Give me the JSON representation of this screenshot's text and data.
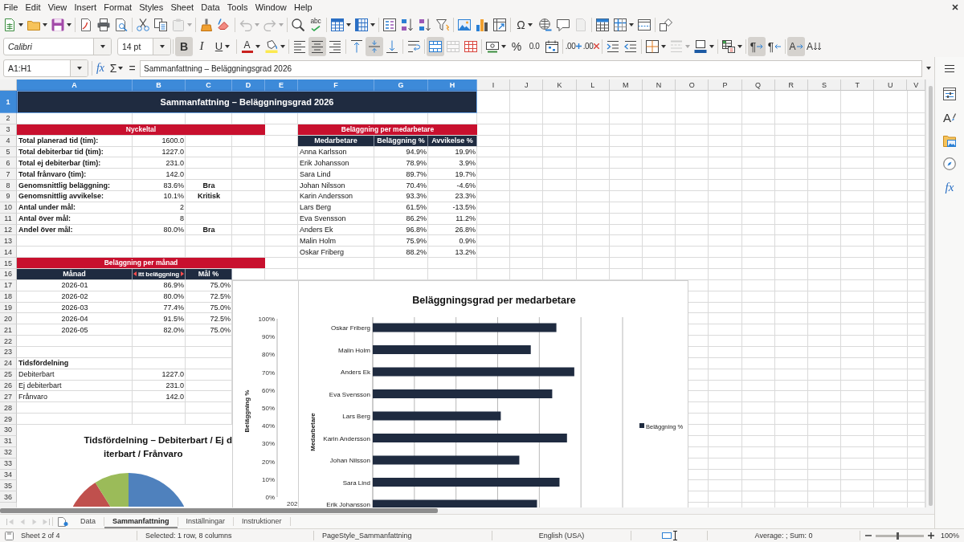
{
  "menu_bar": {
    "items": [
      "File",
      "Edit",
      "View",
      "Insert",
      "Format",
      "Styles",
      "Sheet",
      "Data",
      "Tools",
      "Window",
      "Help"
    ]
  },
  "standard_toolbar": [
    [
      {
        "disabled": false,
        "menu": true
      },
      {
        "disabled": false,
        "menu": true
      },
      {
        "disabled": false,
        "menu": true
      }
    ],
    [
      {
        "disabled": false,
        "menu": false
      },
      {
        "disabled": false,
        "menu": false
      },
      {
        "disabled": false,
        "menu": false
      }
    ],
    [
      {
        "disabled": false,
        "menu": false
      },
      {
        "disabled": false,
        "menu": false
      },
      {
        "disabled": true,
        "menu": true
      }
    ],
    [
      {
        "disabled": false,
        "menu": false
      },
      {
        "disabled": false,
        "menu": false
      }
    ],
    [
      {
        "disabled": true,
        "menu": true
      },
      {
        "disabled": true,
        "menu": true
      }
    ],
    [
      {
        "disabled": false,
        "menu": false
      },
      {
        "label": "abc",
        "disabled": false,
        "menu": false
      }
    ],
    [
      {
        "disabled": false,
        "menu": true
      },
      {
        "disabled": false,
        "menu": true
      }
    ],
    [
      {
        "disabled": false,
        "menu": false
      },
      {
        "disabled": false,
        "menu": false
      },
      {
        "disabled": false,
        "menu": false
      },
      {
        "disabled": false,
        "menu": false
      }
    ],
    [
      {
        "disabled": false,
        "menu": false
      },
      {
        "disabled": false,
        "menu": false
      },
      {
        "disabled": false,
        "menu": false
      }
    ],
    [
      {
        "label": "Ω",
        "disabled": false,
        "menu": true
      },
      {
        "disabled": false,
        "menu": false
      },
      {
        "disabled": false,
        "menu": false
      },
      {
        "disabled": true,
        "menu": false
      }
    ],
    [
      {
        "disabled": false,
        "menu": false
      },
      {
        "disabled": false,
        "menu": true
      },
      {
        "disabled": false,
        "menu": false
      }
    ],
    [
      {
        "disabled": false,
        "menu": false
      }
    ]
  ],
  "formatting_toolbar": {
    "font_name": "Calibri",
    "font_size": "14 pt",
    "groups": [
      [
        {
          "label": "B",
          "pressed": true,
          "disabled": false,
          "menu": false
        },
        {
          "label": "I",
          "pressed": false,
          "disabled": false,
          "menu": false
        },
        {
          "label": "U",
          "pressed": false,
          "disabled": false,
          "menu": true
        }
      ],
      [
        {
          "label": "A",
          "pressed": false,
          "disabled": false,
          "menu": true
        },
        {
          "pressed": false,
          "disabled": false,
          "menu": true
        }
      ],
      [
        {
          "pressed": false,
          "disabled": false,
          "menu": false
        },
        {
          "pressed": true,
          "disabled": false,
          "menu": false
        },
        {
          "pressed": false,
          "disabled": false,
          "menu": false
        }
      ],
      [
        {
          "pressed": false,
          "disabled": false,
          "menu": false
        },
        {
          "pressed": true,
          "disabled": false,
          "menu": false
        },
        {
          "pressed": false,
          "disabled": false,
          "menu": false
        }
      ],
      [
        {
          "pressed": false,
          "disabled": false,
          "menu": false
        }
      ],
      [
        {
          "pressed": true,
          "disabled": false,
          "menu": false
        },
        {
          "pressed": false,
          "disabled": true,
          "menu": false
        },
        {
          "pressed": false,
          "disabled": false,
          "menu": false
        }
      ],
      [
        {
          "pressed": false,
          "disabled": false,
          "menu": true
        },
        {
          "label": "%",
          "pressed": false,
          "disabled": false,
          "menu": false
        },
        {
          "label": "0.0",
          "pressed": false,
          "disabled": false,
          "menu": false
        },
        {
          "pressed": false,
          "disabled": false,
          "menu": false
        }
      ],
      [
        {
          "label": ".00",
          "pressed": false,
          "disabled": false,
          "menu": false
        },
        {
          "label": ".00",
          "pressed": false,
          "disabled": false,
          "menu": false
        }
      ],
      [
        {
          "pressed": false,
          "disabled": false,
          "menu": false
        },
        {
          "pressed": false,
          "disabled": false,
          "menu": false
        }
      ],
      [
        {
          "pressed": false,
          "disabled": false,
          "menu": true
        },
        {
          "pressed": false,
          "disabled": true,
          "menu": true
        },
        {
          "pressed": false,
          "disabled": false,
          "menu": true
        }
      ],
      [
        {
          "pressed": false,
          "disabled": false,
          "menu": true
        }
      ],
      [
        {
          "label": "¶",
          "pressed": true,
          "disabled": false,
          "menu": false
        },
        {
          "label": "¶",
          "pressed": false,
          "disabled": false,
          "menu": false
        }
      ],
      [
        {
          "label": "A",
          "pressed": true,
          "disabled": false,
          "menu": false
        },
        {
          "label": "A",
          "pressed": false,
          "disabled": false,
          "menu": false
        }
      ]
    ]
  },
  "formula_bar": {
    "name_box": "A1:H1",
    "function_wizard": "fx",
    "sum": "Σ",
    "equals": "=",
    "content": "Sammanfattning – Beläggningsgrad 2026"
  },
  "sidebar": {
    "styles": "A",
    "functions": "fx"
  },
  "sheet": {
    "columns": [
      {
        "label": "A",
        "selected": true
      },
      {
        "label": "B",
        "selected": true
      },
      {
        "label": "C",
        "selected": true
      },
      {
        "label": "D",
        "selected": true
      },
      {
        "label": "E",
        "selected": true
      },
      {
        "label": "F",
        "selected": true
      },
      {
        "label": "G",
        "selected": true
      },
      {
        "label": "H",
        "selected": true
      },
      {
        "label": "I",
        "selected": false
      },
      {
        "label": "J",
        "selected": false
      },
      {
        "label": "K",
        "selected": false
      },
      {
        "label": "L",
        "selected": false
      },
      {
        "label": "M",
        "selected": false
      },
      {
        "label": "N",
        "selected": false
      },
      {
        "label": "O",
        "selected": false
      },
      {
        "label": "P",
        "selected": false
      },
      {
        "label": "Q",
        "selected": false
      },
      {
        "label": "R",
        "selected": false
      },
      {
        "label": "S",
        "selected": false
      },
      {
        "label": "T",
        "selected": false
      },
      {
        "label": "U",
        "selected": false
      },
      {
        "label": "V",
        "selected": false
      }
    ],
    "rows": [
      {
        "label": "1",
        "selected": true
      },
      {
        "label": "2",
        "selected": false
      },
      {
        "label": "3",
        "selected": false
      },
      {
        "label": "4",
        "selected": false
      },
      {
        "label": "5",
        "selected": false
      },
      {
        "label": "6",
        "selected": false
      },
      {
        "label": "7",
        "selected": false
      },
      {
        "label": "8",
        "selected": false
      },
      {
        "label": "9",
        "selected": false
      },
      {
        "label": "10",
        "selected": false
      },
      {
        "label": "11",
        "selected": false
      },
      {
        "label": "12",
        "selected": false
      },
      {
        "label": "13",
        "selected": false
      },
      {
        "label": "14",
        "selected": false
      },
      {
        "label": "15",
        "selected": false
      },
      {
        "label": "16",
        "selected": false
      },
      {
        "label": "17",
        "selected": false
      },
      {
        "label": "18",
        "selected": false
      },
      {
        "label": "19",
        "selected": false
      },
      {
        "label": "20",
        "selected": false
      },
      {
        "label": "21",
        "selected": false
      },
      {
        "label": "22",
        "selected": false
      },
      {
        "label": "23",
        "selected": false
      },
      {
        "label": "24",
        "selected": false
      },
      {
        "label": "25",
        "selected": false
      },
      {
        "label": "26",
        "selected": false
      },
      {
        "label": "27",
        "selected": false
      },
      {
        "label": "28",
        "selected": false
      },
      {
        "label": "29",
        "selected": false
      },
      {
        "label": "30",
        "selected": false
      },
      {
        "label": "31",
        "selected": false
      },
      {
        "label": "32",
        "selected": false
      },
      {
        "label": "33",
        "selected": false
      },
      {
        "label": "34",
        "selected": false
      },
      {
        "label": "35",
        "selected": false
      },
      {
        "label": "36",
        "selected": false
      }
    ],
    "title": "Sammanfattning – Beläggningsgrad 2026",
    "key_figures": {
      "heading": "Nyckeltal",
      "rows": [
        {
          "label": "Total planerad tid (tim):",
          "value": "1600.0"
        },
        {
          "label": "Total debiterbar tid (tim):",
          "value": "1227.0"
        },
        {
          "label": "Total ej debiterbar (tim):",
          "value": "231.0"
        },
        {
          "label": "Total frånvaro (tim):",
          "value": "142.0"
        },
        {
          "label": "Genomsnittlig beläggning:",
          "value": "83.6%",
          "status": "Bra"
        },
        {
          "label": "Genomsnittlig avvikelse:",
          "value": "10.1%",
          "status": "Kritisk"
        },
        {
          "label": "Antal under mål:",
          "value": "2"
        },
        {
          "label": "Antal över mål:",
          "value": "8"
        },
        {
          "label": "Andel över mål:",
          "value": "80.0%",
          "status": "Bra"
        }
      ]
    },
    "employees": {
      "heading": "Beläggning per medarbetare",
      "columns": [
        "Medarbetare",
        "Beläggning %",
        "Avvikelse %"
      ],
      "rows": [
        {
          "name": "Anna Karlsson",
          "occupancy": "94.9%",
          "deviation": "19.9%"
        },
        {
          "name": "Erik Johansson",
          "occupancy": "78.9%",
          "deviation": "3.9%"
        },
        {
          "name": "Sara Lind",
          "occupancy": "89.7%",
          "deviation": "19.7%"
        },
        {
          "name": "Johan Nilsson",
          "occupancy": "70.4%",
          "deviation": "-4.6%"
        },
        {
          "name": "Karin Andersson",
          "occupancy": "93.3%",
          "deviation": "23.3%"
        },
        {
          "name": "Lars Berg",
          "occupancy": "61.5%",
          "deviation": "-13.5%"
        },
        {
          "name": "Eva Svensson",
          "occupancy": "86.2%",
          "deviation": "11.2%"
        },
        {
          "name": "Anders Ek",
          "occupancy": "96.8%",
          "deviation": "26.8%"
        },
        {
          "name": "Malin Holm",
          "occupancy": "75.9%",
          "deviation": "0.9%"
        },
        {
          "name": "Oskar Friberg",
          "occupancy": "88.2%",
          "deviation": "13.2%"
        }
      ]
    },
    "monthly": {
      "heading": "Beläggning per månad",
      "columns": [
        {
          "label": "Månad",
          "overflow": false
        },
        {
          "label": "itt beläggning",
          "overflow": true
        },
        {
          "label": "Mål %",
          "overflow": false
        }
      ],
      "rows": [
        {
          "month": "2026-01",
          "occupancy": "86.9%",
          "target": "75.0%"
        },
        {
          "month": "2026-02",
          "occupancy": "80.0%",
          "target": "72.5%"
        },
        {
          "month": "2026-03",
          "occupancy": "77.4%",
          "target": "75.0%"
        },
        {
          "month": "2026-04",
          "occupancy": "91.5%",
          "target": "72.5%"
        },
        {
          "month": "2026-05",
          "occupancy": "82.0%",
          "target": "75.0%"
        }
      ]
    },
    "time_split": {
      "heading": "Tidsfördelning",
      "rows": [
        {
          "label": "Debiterbart",
          "value": "1227.0"
        },
        {
          "label": "Ej debiterbart",
          "value": "231.0"
        },
        {
          "label": "Frånvaro",
          "value": "142.0"
        }
      ]
    }
  },
  "column_chart": {
    "chart_data": {
      "type": "bar",
      "ylabel": "Beläggning %",
      "categories": [
        "202"
      ],
      "ylim": [
        0,
        100
      ],
      "yticks": [
        {
          "value": 0,
          "label": "0%"
        },
        {
          "value": 10,
          "label": "10%"
        },
        {
          "value": 20,
          "label": "20%"
        },
        {
          "value": 30,
          "label": "30%"
        },
        {
          "value": 40,
          "label": "40%"
        },
        {
          "value": 50,
          "label": "50%"
        },
        {
          "value": 60,
          "label": "60%"
        },
        {
          "value": 70,
          "label": "70%"
        },
        {
          "value": 80,
          "label": "80%"
        },
        {
          "value": 90,
          "label": "90%"
        },
        {
          "value": 100,
          "label": "100%"
        }
      ]
    }
  },
  "bar_chart": {
    "title": "Beläggningsgrad per medarbetare",
    "axis_title": "Medarbetare",
    "categories": [
      "Oskar Friberg",
      "Malin Holm",
      "Anders Ek",
      "Eva Svensson",
      "Lars Berg",
      "Karin Andersson",
      "Johan Nilsson",
      "Sara Lind",
      "Erik Johansson"
    ],
    "legend": "Beläggning %"
  },
  "pie_chart": {
    "title": [
      "Tidsfördelning – Debiterbart / Ej d",
      "iterbart / Frånvaro"
    ]
  },
  "sheet_navigation": [
    {
      "disabled": true
    },
    {
      "disabled": true
    },
    {
      "disabled": true
    },
    {
      "disabled": true
    }
  ],
  "sheet_tabs": [
    {
      "label": "Data",
      "selected": false
    },
    {
      "label": "Sammanfattning",
      "selected": true
    },
    {
      "label": "Inställningar",
      "selected": false
    },
    {
      "label": "Instruktioner",
      "selected": false
    }
  ],
  "status_bar": {
    "sheet": "Sheet 2 of 4",
    "selection": "Selected: 1 row, 8 columns",
    "page_style": "PageStyle_Sammanfattning",
    "language": "English (USA)",
    "summary": "Average: ; Sum: 0",
    "zoom": {
      "level": 0.46,
      "label": "100%"
    }
  }
}
